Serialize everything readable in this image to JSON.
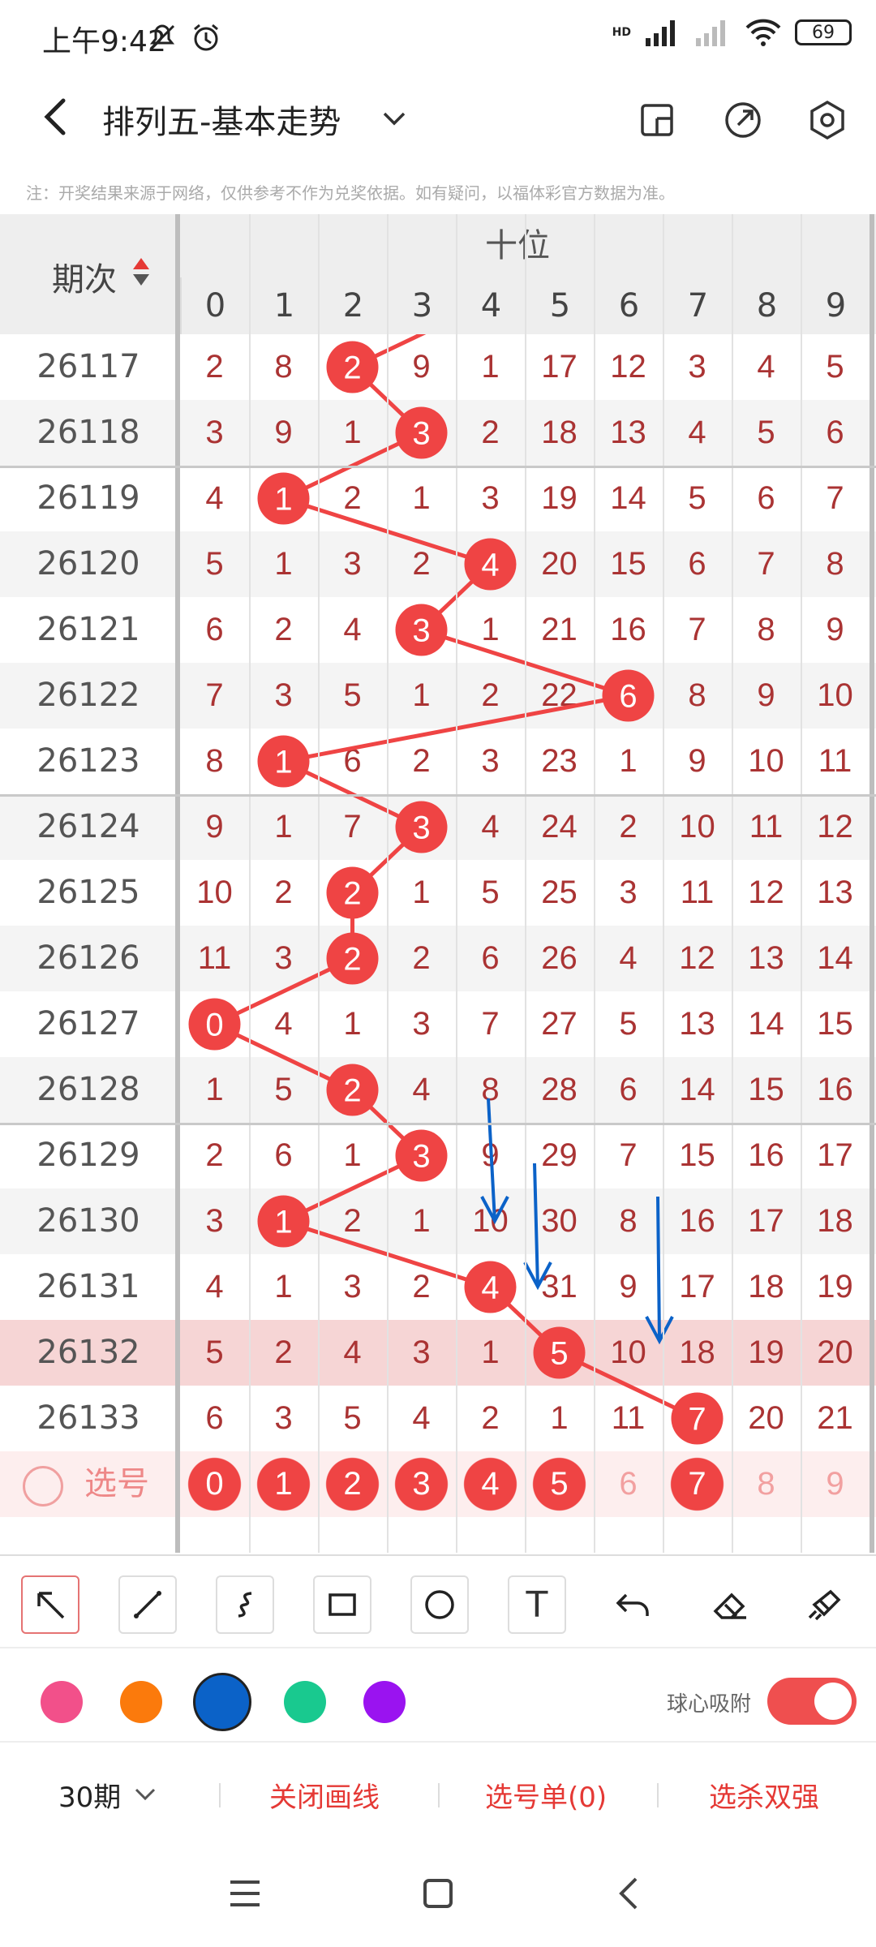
{
  "status": {
    "time": "上午9:42",
    "battery": "69",
    "network": "HD"
  },
  "header": {
    "title": "排列五-基本走势"
  },
  "notice": "注：开奖结果来源于网络，仅供参考不作为兑奖依据。如有疑问，以福体彩官方数据为准。",
  "table": {
    "issue_header": "期次",
    "group_header": "十位",
    "digit_headers": [
      "0",
      "1",
      "2",
      "3",
      "4",
      "5",
      "6",
      "7",
      "8",
      "9"
    ],
    "rows": [
      {
        "issue": "26117",
        "cells": [
          "2",
          "8",
          "2",
          "9",
          "1",
          "17",
          "12",
          "3",
          "4",
          "5"
        ]
      },
      {
        "issue": "26118",
        "cells": [
          "3",
          "9",
          "1",
          "3",
          "2",
          "18",
          "13",
          "4",
          "5",
          "6"
        ]
      },
      {
        "issue": "26119",
        "cells": [
          "4",
          "1",
          "2",
          "1",
          "3",
          "19",
          "14",
          "5",
          "6",
          "7"
        ]
      },
      {
        "issue": "26120",
        "cells": [
          "5",
          "1",
          "3",
          "2",
          "4",
          "20",
          "15",
          "6",
          "7",
          "8"
        ]
      },
      {
        "issue": "26121",
        "cells": [
          "6",
          "2",
          "4",
          "3",
          "1",
          "21",
          "16",
          "7",
          "8",
          "9"
        ]
      },
      {
        "issue": "26122",
        "cells": [
          "7",
          "3",
          "5",
          "1",
          "2",
          "22",
          "6",
          "8",
          "9",
          "10"
        ]
      },
      {
        "issue": "26123",
        "cells": [
          "8",
          "1",
          "6",
          "2",
          "3",
          "23",
          "1",
          "9",
          "10",
          "11"
        ]
      },
      {
        "issue": "26124",
        "cells": [
          "9",
          "1",
          "7",
          "3",
          "4",
          "24",
          "2",
          "10",
          "11",
          "12"
        ]
      },
      {
        "issue": "26125",
        "cells": [
          "10",
          "2",
          "2",
          "1",
          "5",
          "25",
          "3",
          "11",
          "12",
          "13"
        ]
      },
      {
        "issue": "26126",
        "cells": [
          "11",
          "3",
          "2",
          "2",
          "6",
          "26",
          "4",
          "12",
          "13",
          "14"
        ]
      },
      {
        "issue": "26127",
        "cells": [
          "0",
          "4",
          "1",
          "3",
          "7",
          "27",
          "5",
          "13",
          "14",
          "15"
        ]
      },
      {
        "issue": "26128",
        "cells": [
          "1",
          "5",
          "2",
          "4",
          "8",
          "28",
          "6",
          "14",
          "15",
          "16"
        ]
      },
      {
        "issue": "26129",
        "cells": [
          "2",
          "6",
          "1",
          "3",
          "9",
          "29",
          "7",
          "15",
          "16",
          "17"
        ]
      },
      {
        "issue": "26130",
        "cells": [
          "3",
          "1",
          "2",
          "1",
          "10",
          "30",
          "8",
          "16",
          "17",
          "18"
        ]
      },
      {
        "issue": "26131",
        "cells": [
          "4",
          "1",
          "3",
          "2",
          "4",
          "31",
          "9",
          "17",
          "18",
          "19"
        ]
      },
      {
        "issue": "26132",
        "cells": [
          "5",
          "2",
          "4",
          "3",
          "1",
          "5",
          "10",
          "18",
          "19",
          "20"
        ]
      },
      {
        "issue": "26133",
        "cells": [
          "6",
          "3",
          "5",
          "4",
          "2",
          "1",
          "11",
          "7",
          "20",
          "21"
        ]
      }
    ],
    "drawn_digits": [
      2,
      3,
      1,
      4,
      3,
      6,
      1,
      3,
      2,
      2,
      0,
      2,
      3,
      1,
      4,
      5,
      7
    ],
    "select_label": "选号",
    "select_row": [
      "0",
      "1",
      "2",
      "3",
      "4",
      "5",
      "6",
      "7",
      "8",
      "9"
    ],
    "select_active": [
      0,
      1,
      2,
      3,
      4,
      5,
      7
    ]
  },
  "toolbar": {
    "tools": [
      "arrow-tool",
      "line-tool",
      "curve-tool",
      "rect-tool",
      "circle-tool",
      "text-tool",
      "undo-tool",
      "eraser-tool",
      "clear-tool"
    ],
    "text_tool_glyph": "T"
  },
  "colors": {
    "swatches": [
      "#f2508a",
      "#fb7a0c",
      "#0b62c8",
      "#19c98f",
      "#9a13f0"
    ],
    "selected": "#0b62c8",
    "snap_label": "球心吸附",
    "accent": "#ef4f4f"
  },
  "bottom": {
    "period": "30期",
    "close_lines": "关闭画线",
    "pick_list": "选号单(0)",
    "filter": "选杀双强"
  }
}
